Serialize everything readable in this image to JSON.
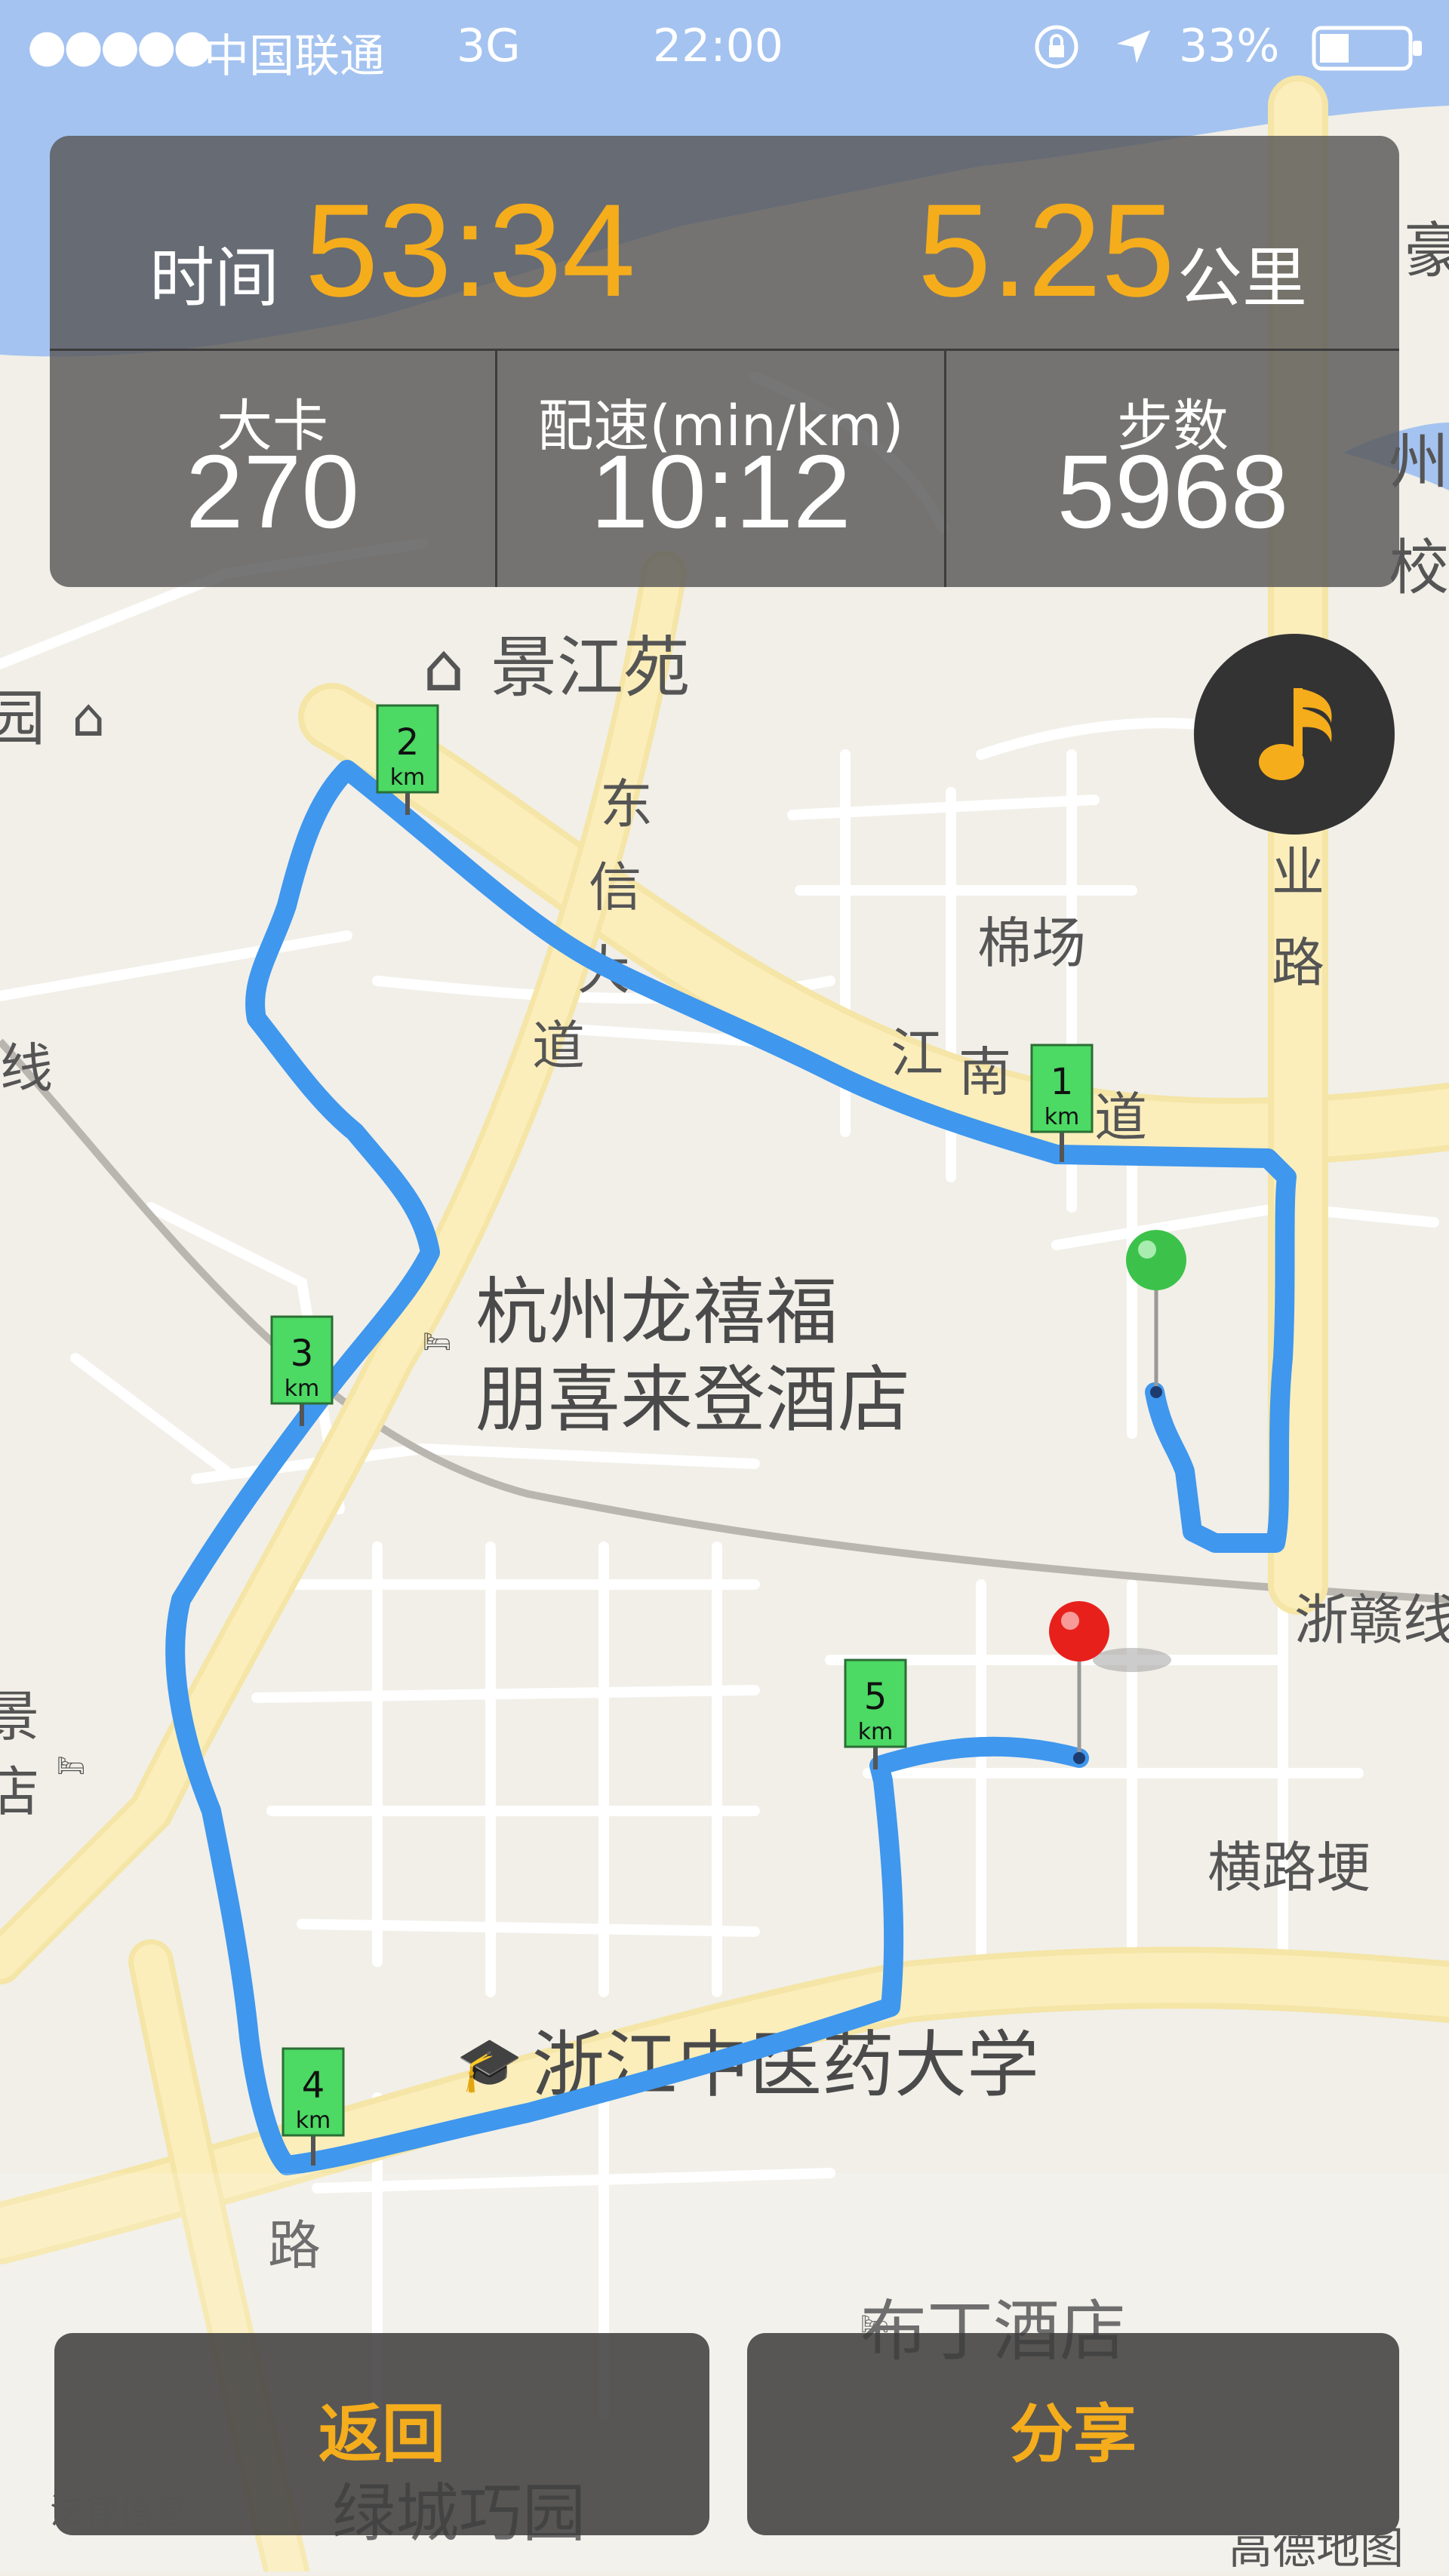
{
  "status_bar": {
    "signal": "●●●●●",
    "carrier": "中国联通",
    "network": "3G",
    "time": "22:00",
    "battery_percent": "33%"
  },
  "stats": {
    "time_label": "时间",
    "time_value": "53:34",
    "distance_value": "5.25",
    "distance_unit": "公里",
    "calories_label": "大卡",
    "calories_value": "270",
    "pace_label": "配速(min/km)",
    "pace_value": "10:12",
    "steps_label": "步数",
    "steps_value": "5968"
  },
  "map_labels": {
    "jingjiangyuan": "景江苑",
    "mianchang": "棉场",
    "hotel_line1": "杭州龙禧福",
    "hotel_line2": "朋喜来登酒店",
    "zhegan": "浙赣线",
    "henglugeng": "横路埂",
    "university": "浙江中医药大学",
    "buding_hotel": "布丁酒店",
    "lvcheng": "绿城巧园",
    "road_dongxin_1": "东",
    "road_dongxin_2": "信",
    "road_dongxin_3": "大",
    "road_dongxin_4": "道",
    "road_jiangnan_1": "江",
    "road_jiangnan_2": "南",
    "road_jiangnan_3": "道",
    "road_ye": "业",
    "road_lu": "路",
    "road_left_lu": "路",
    "edge_hao": "豪",
    "edge_zhou": "州",
    "edge_xiao": "校",
    "edge_yuan": "园",
    "edge_xian": "线",
    "edge_jing": "景",
    "edge_dian": "店"
  },
  "km_markers": [
    "1",
    "2",
    "3",
    "4",
    "5"
  ],
  "km_unit": "km",
  "buttons": {
    "back": "返回",
    "share": "分享"
  },
  "footer": {
    "legal": "法律信息",
    "brand": "高德地图"
  },
  "colors": {
    "accent": "#f5ad1c",
    "route": "#3f97ee",
    "marker_green": "#4cd964",
    "start_pin": "#3cc24a",
    "end_pin": "#e8201b"
  },
  "icons": {
    "music": "music-note-icon",
    "start": "green-pin-icon",
    "end": "red-pin-icon"
  }
}
